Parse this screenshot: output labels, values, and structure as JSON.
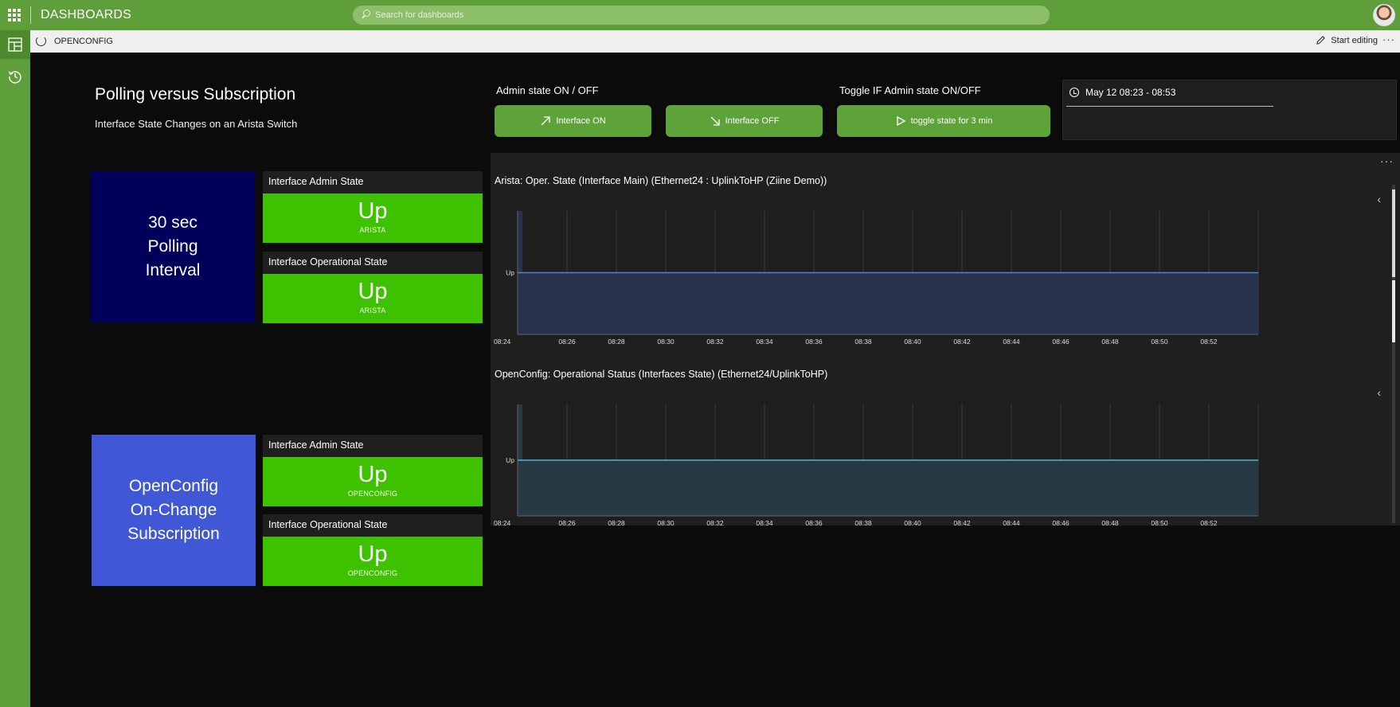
{
  "topbar": {
    "title": "DASHBOARDS",
    "search_placeholder": "Search for dashboards"
  },
  "subbar": {
    "breadcrumb": "OPENCONFIG",
    "edit_label": "Start editing",
    "more": "···"
  },
  "header": {
    "title": "Polling versus Subscription",
    "subtitle": "Interface State Changes on an Arista Switch"
  },
  "controls": {
    "admin_label": "Admin state ON / OFF",
    "toggle_label": "Toggle IF Admin state ON/OFF",
    "btn_on": "Interface ON",
    "btn_off": "Interface OFF",
    "btn_toggle": "toggle state for 3 min"
  },
  "time_range": {
    "label": "May 12 08:23 - 08:53"
  },
  "sections": [
    {
      "tile_text": "30 sec\nPolling\nInterval",
      "tile_color": "#00005a",
      "stats": [
        {
          "title": "Interface Admin State",
          "value": "Up",
          "source": "ARISTA"
        },
        {
          "title": "Interface Operational State",
          "value": "Up",
          "source": "ARISTA"
        }
      ]
    },
    {
      "tile_text": "OpenConfig\nOn-Change\nSubscription",
      "tile_color": "#4058d6",
      "stats": [
        {
          "title": "Interface Admin State",
          "value": "Up",
          "source": "OPENCONFIG"
        },
        {
          "title": "Interface Operational State",
          "value": "Up",
          "source": "OPENCONFIG"
        }
      ]
    }
  ],
  "panel": {
    "more": "···"
  },
  "chart_data": [
    {
      "type": "area",
      "title": "Arista: Oper. State (Interface Main) (Ethernet24 : UplinkToHP (Ziine Demo))",
      "x_ticks": [
        "08:24",
        "08:26",
        "08:28",
        "08:30",
        "08:32",
        "08:34",
        "08:36",
        "08:38",
        "08:40",
        "08:42",
        "08:44",
        "08:46",
        "08:48",
        "08:50",
        "08:52"
      ],
      "y_ticks": [
        "Up"
      ],
      "series": [
        {
          "values": [
            "Up",
            "Up",
            "Up",
            "Up",
            "Up",
            "Up",
            "Up",
            "Up",
            "Up",
            "Up",
            "Up",
            "Up",
            "Up",
            "Up",
            "Up"
          ]
        }
      ],
      "line_color": "#4f86d9",
      "fill_color": "#28324a"
    },
    {
      "type": "area",
      "title": "OpenConfig: Operational Status (Interfaces State) (Ethernet24/UplinkToHP)",
      "x_ticks": [
        "08:24",
        "08:26",
        "08:28",
        "08:30",
        "08:32",
        "08:34",
        "08:36",
        "08:38",
        "08:40",
        "08:42",
        "08:44",
        "08:46",
        "08:48",
        "08:50",
        "08:52"
      ],
      "y_ticks": [
        "Up"
      ],
      "series": [
        {
          "values": [
            "Up",
            "Up",
            "Up",
            "Up",
            "Up",
            "Up",
            "Up",
            "Up",
            "Up",
            "Up",
            "Up",
            "Up",
            "Up",
            "Up",
            "Up"
          ]
        }
      ],
      "line_color": "#4fb6dc",
      "fill_color": "#273a44"
    }
  ]
}
